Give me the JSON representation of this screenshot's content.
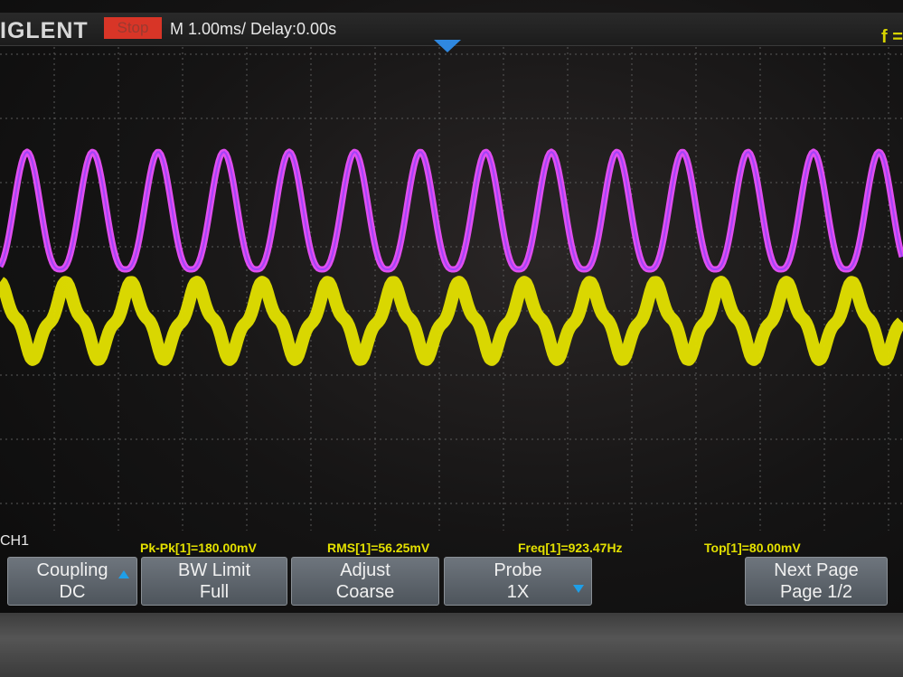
{
  "header": {
    "brand": "IGLENT",
    "run_status": "Stop",
    "timebase": "M 1.00ms/ Delay:0.00s",
    "trigger_label": "f ="
  },
  "info": {
    "channel": "CH1",
    "measurements": [
      {
        "label": "Pk-Pk[1]=180.00mV"
      },
      {
        "label": "RMS[1]=56.25mV"
      },
      {
        "label": "Freq[1]=923.47Hz"
      },
      {
        "label": "Top[1]=80.00mV"
      }
    ]
  },
  "softkeys": [
    {
      "line1": "Coupling",
      "line2": "DC",
      "icon": "up-arrow-icon"
    },
    {
      "line1": "BW Limit",
      "line2": "Full",
      "icon": ""
    },
    {
      "line1": "Adjust",
      "line2": "Coarse",
      "icon": ""
    },
    {
      "line1": "Probe",
      "line2": "1X",
      "icon": "down-arrow-icon"
    },
    {
      "line1": "Next Page",
      "line2": "Page 1/2",
      "icon": ""
    }
  ],
  "colors": {
    "ch1_trace": "#e4e200",
    "ch2_trace": "#e04ef0",
    "run_status": "#d83527",
    "measurement_text": "#e3e000",
    "trigger_marker": "#2f88e0"
  }
}
